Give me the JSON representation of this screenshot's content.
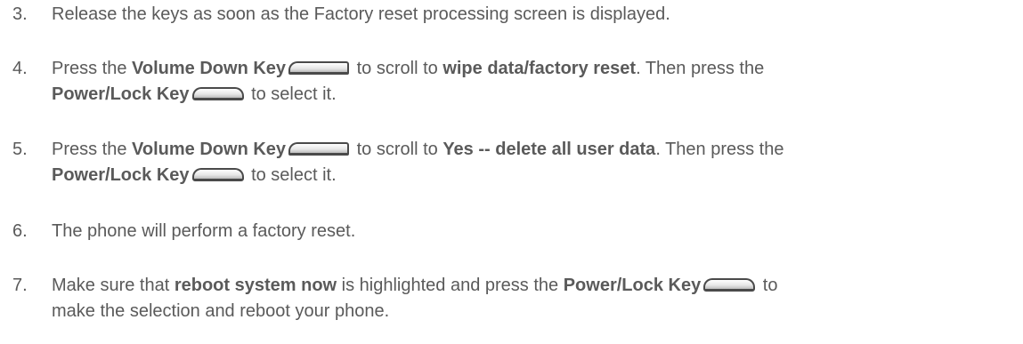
{
  "steps": [
    {
      "number": "3.",
      "text": "Release the keys as soon as the Factory reset processing screen is displayed."
    },
    {
      "number": "4.",
      "t1": "Press the ",
      "b1": "Volume Down Key",
      "t2": " to scroll to ",
      "b2": "wipe data/factory reset",
      "t3": ". Then press the",
      "b3": "Power/Lock Key",
      "t4": " to select it."
    },
    {
      "number": "5.",
      "t1": "Press the ",
      "b1": "Volume Down Key",
      "t2": " to scroll to ",
      "b2": "Yes -- delete all user data",
      "t3": ". Then press the",
      "b3": "Power/Lock Key",
      "t4": " to select it."
    },
    {
      "number": "6.",
      "text": "The phone will perform a factory reset."
    },
    {
      "number": "7.",
      "t1": "Make sure that ",
      "b1": "reboot system now",
      "t2": " is highlighted and press the ",
      "b2": "Power/Lock Key",
      "t3": " to",
      "t4": "make the selection and reboot your phone."
    }
  ],
  "icons": {
    "volume_key": "volume-down-key-icon",
    "power_key": "power-lock-key-icon"
  }
}
